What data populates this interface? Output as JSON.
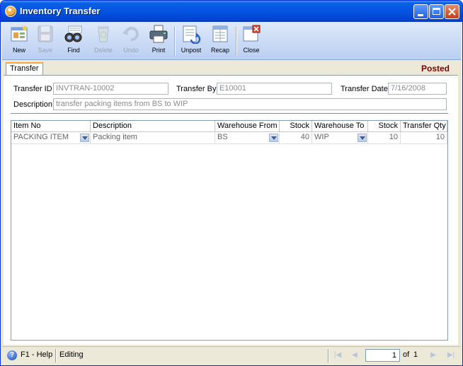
{
  "window": {
    "title": "Inventory Transfer"
  },
  "toolbar": {
    "new": "New",
    "save": "Save",
    "find": "Find",
    "delete": "Delete",
    "undo": "Undo",
    "print": "Print",
    "unpost": "Unpost",
    "recap": "Recap",
    "close": "Close"
  },
  "tabs": [
    {
      "label": "Transfer"
    }
  ],
  "status": "Posted",
  "form": {
    "transfer_id_label": "Transfer ID",
    "transfer_id": "INVTRAN-10002",
    "transfer_by_label": "Transfer By",
    "transfer_by": "E10001",
    "transfer_date_label": "Transfer Date",
    "transfer_date": "7/16/2008",
    "description_label": "Description",
    "description": "transfer packing items from BS to WIP"
  },
  "grid": {
    "columns": [
      "Item No",
      "Description",
      "Warehouse From",
      "Stock",
      "Warehouse To",
      "Stock",
      "Transfer Qty"
    ],
    "rows": [
      {
        "item_no": "PACKING ITEM",
        "description": "Packing item",
        "warehouse_from": "BS",
        "stock_from": "40",
        "warehouse_to": "WIP",
        "stock_to": "10",
        "transfer_qty": "10"
      }
    ]
  },
  "statusbar": {
    "help": "F1 - Help",
    "mode": "Editing",
    "page": "1",
    "of_label": "of",
    "total_pages": "1"
  },
  "colors": {
    "titlebar": "#0554e3",
    "posted": "#800000",
    "toolbar": "#c9d9f4"
  }
}
